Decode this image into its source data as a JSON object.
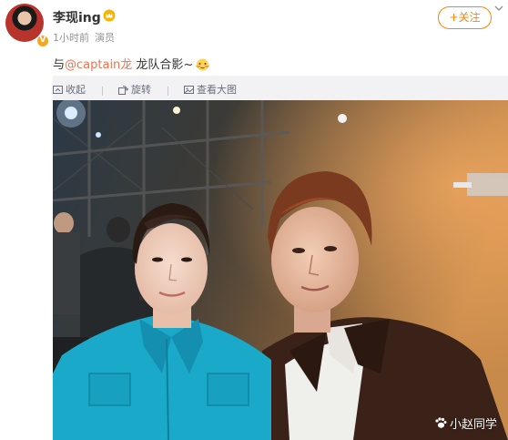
{
  "post": {
    "username": "李现ing",
    "time": "1小时前",
    "source": "演员",
    "follow_label": "+关注",
    "text_prefix": "与",
    "mention": "@captain龙",
    "text_suffix": " 龙队合影~"
  },
  "actions": {
    "collapse_label": "收起",
    "rotate_label": "旋转",
    "view_large_label": "查看大图"
  },
  "photo": {
    "watermark": "小赵同学"
  },
  "colors": {
    "accent": "#ff8200",
    "mention": "#eb7350"
  },
  "icons": {
    "verified": "verified-badge-icon",
    "vip": "crown-icon",
    "more": "chevron-down-icon",
    "emoji": "shy-face-emoji-icon",
    "watermark": "paw-icon"
  }
}
